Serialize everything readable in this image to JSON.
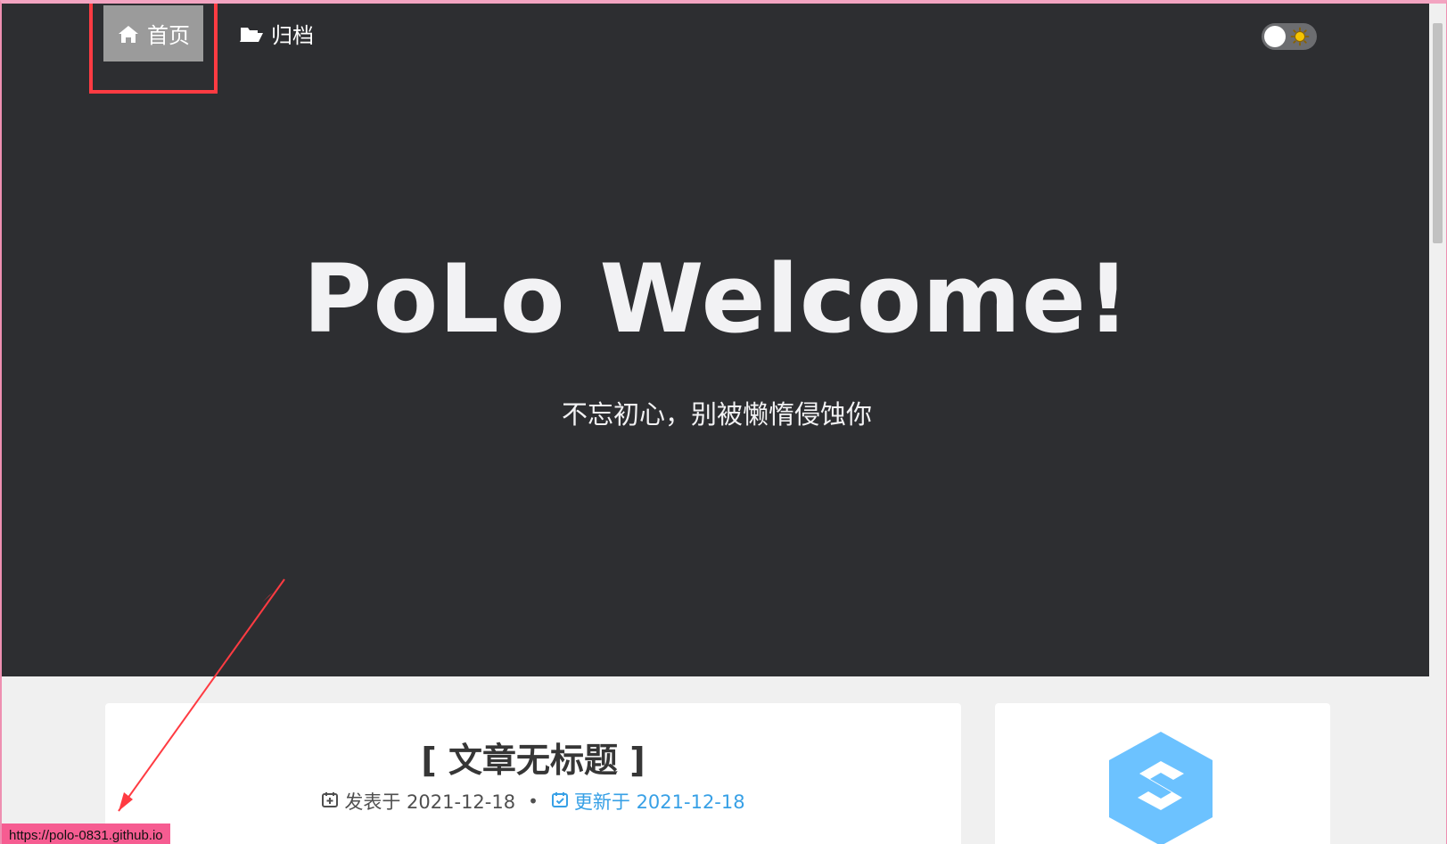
{
  "nav": {
    "home_label": "首页",
    "archive_label": "归档",
    "home_icon": "home-icon",
    "archive_icon": "folder-open-icon"
  },
  "theme_toggle": {
    "state": "light",
    "icon": "sun-icon"
  },
  "hero": {
    "title": "PoLo Welcome!",
    "subtitle": "不忘初心，别被懒惰侵蚀你"
  },
  "post": {
    "title": "[ 文章无标题 ]",
    "published_label": "发表于 2021-12-18",
    "separator": "•",
    "updated_label": "更新于 2021-12-18",
    "published_icon": "calendar-plus-icon",
    "updated_icon": "calendar-check-icon"
  },
  "sidebar": {
    "logo_icon": "hexagon-s-logo"
  },
  "status_bar": {
    "url": "https://polo-0831.github.io"
  },
  "colors": {
    "hero_bg": "#2d2e31",
    "page_bg": "#f0f0f0",
    "link_blue": "#37a0e6",
    "annotation_red": "#ff3b42",
    "status_pink": "#f65c91",
    "logo_blue": "#6cc2ff"
  }
}
